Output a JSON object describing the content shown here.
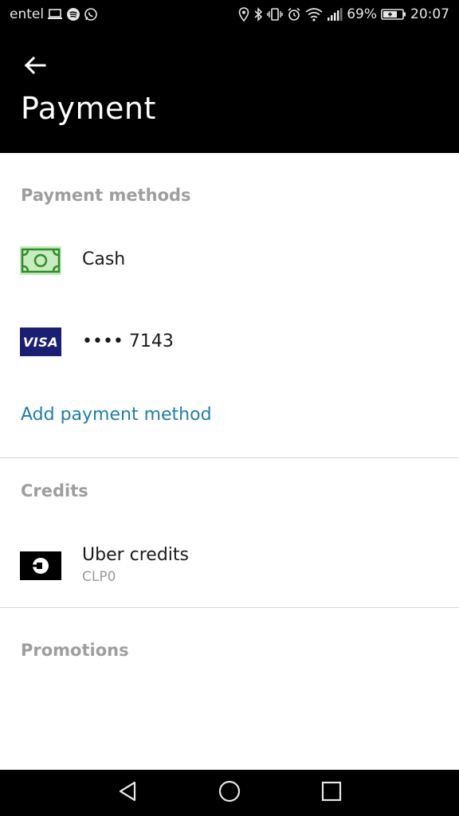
{
  "status_bar": {
    "carrier": "entel",
    "battery_percent": "69%",
    "time": "20:07",
    "left_icons": [
      "laptop-icon",
      "spotify-icon",
      "whatsapp-icon"
    ],
    "right_icons": [
      "location-icon",
      "bluetooth-icon",
      "vibrate-icon",
      "alarm-icon",
      "wifi-icon",
      "signal-icon",
      "battery-icon"
    ]
  },
  "header": {
    "title": "Payment",
    "back_icon": "back-arrow-icon"
  },
  "payment_methods": {
    "title": "Payment methods",
    "items": [
      {
        "icon": "cash-icon",
        "label": "Cash",
        "icon_color": "#c9ecbf"
      },
      {
        "icon": "visa-icon",
        "label": "•••• 7143",
        "icon_text": "VISA",
        "icon_color": "#1a1f71"
      }
    ],
    "add_label": "Add payment method"
  },
  "credits": {
    "title": "Credits",
    "items": [
      {
        "icon": "uber-icon",
        "label": "Uber credits",
        "sublabel": "CLP0"
      }
    ]
  },
  "promotions": {
    "title": "Promotions"
  },
  "nav_bar": {
    "buttons": [
      "back-triangle-icon",
      "home-circle-icon",
      "recents-square-icon"
    ]
  },
  "colors": {
    "accent_link": "#1f7dab",
    "header_bg": "#000000",
    "section_header": "#9e9e9e"
  }
}
